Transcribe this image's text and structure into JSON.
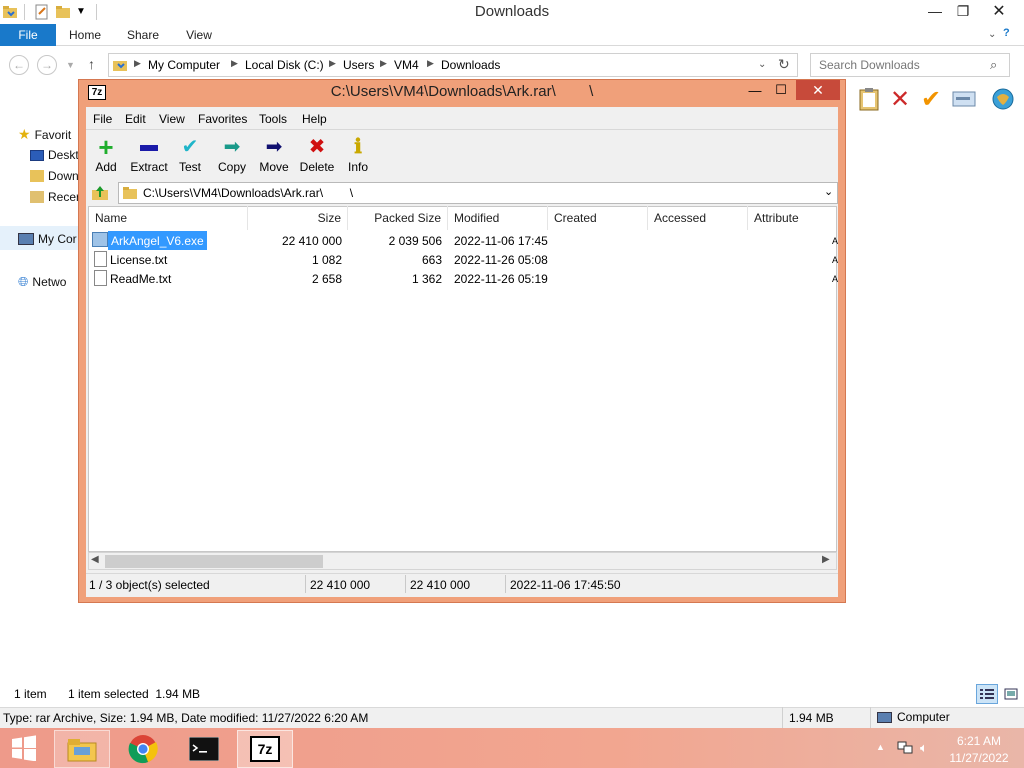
{
  "explorer": {
    "title": "Downloads",
    "ribbon": {
      "file": "File",
      "home": "Home",
      "share": "Share",
      "view": "View"
    },
    "breadcrumb": [
      "My Computer",
      "Local Disk (C:)",
      "Users",
      "VM4",
      "Downloads"
    ],
    "search_placeholder": "Search Downloads",
    "nav": {
      "favorites": "Favorit",
      "desktop": "Deskt",
      "downloads": "Down",
      "recent": "Recer",
      "computer": "My Cor",
      "network": "Netwo"
    },
    "status": {
      "items": "1 item",
      "selected": "1 item selected  1.94 MB"
    },
    "details": {
      "type": "Type: rar Archive, Size: 1.94 MB, Date modified: 11/27/2022 6:20 AM",
      "size": "1.94 MB",
      "location": "Computer"
    }
  },
  "sevenzip": {
    "title": "C:\\Users\\VM4\\Downloads\\Ark.rar\\        \\",
    "menu": [
      "File",
      "Edit",
      "View",
      "Favorites",
      "Tools",
      "Help"
    ],
    "toolbar": [
      {
        "label": "Add",
        "icon": "plus-icon",
        "color": "#1fae2d"
      },
      {
        "label": "Extract",
        "icon": "minus-icon",
        "color": "#1a1aa8"
      },
      {
        "label": "Test",
        "icon": "check-icon",
        "color": "#1fb5c9"
      },
      {
        "label": "Copy",
        "icon": "copy-arrow-icon",
        "color": "#1a9a8a"
      },
      {
        "label": "Move",
        "icon": "move-arrow-icon",
        "color": "#101070"
      },
      {
        "label": "Delete",
        "icon": "delete-icon",
        "color": "#d01010"
      },
      {
        "label": "Info",
        "icon": "info-icon",
        "color": "#d6b800"
      }
    ],
    "path": "C:\\Users\\VM4\\Downloads\\Ark.rar\\        \\",
    "columns": [
      "Name",
      "Size",
      "Packed Size",
      "Modified",
      "Created",
      "Accessed",
      "Attribute"
    ],
    "files": [
      {
        "name": "ArkAngel_V6.exe",
        "size": "22 410 000",
        "packed": "2 039 506",
        "modified": "2022-11-06 17:45",
        "selected": true
      },
      {
        "name": "License.txt",
        "size": "1 082",
        "packed": "663",
        "modified": "2022-11-26 05:08",
        "selected": false
      },
      {
        "name": "ReadMe.txt",
        "size": "2 658",
        "packed": "1 362",
        "modified": "2022-11-26 05:19",
        "selected": false
      }
    ],
    "status": {
      "selected": "1 / 3 object(s) selected",
      "size": "22 410 000",
      "packed": "22 410 000",
      "modified": "2022-11-06 17:45:50"
    }
  },
  "taskbar": {
    "time": "6:21 AM",
    "date": "11/27/2022",
    "apps": [
      "file-explorer-icon",
      "chrome-icon",
      "cmd-icon",
      "7zip-icon"
    ]
  },
  "colors": {
    "accent": "#1979ca",
    "zip_frame": "#f0a07a",
    "selection": "#3399ff",
    "taskbar": "#f0a08e"
  }
}
